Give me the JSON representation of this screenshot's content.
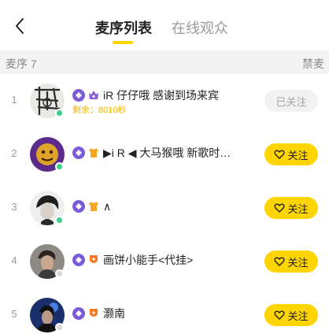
{
  "header": {
    "tabs": [
      {
        "label": "麦序列表",
        "active": true
      },
      {
        "label": "在线观众",
        "active": false
      }
    ],
    "accent_color": "#ffd500"
  },
  "subbar": {
    "queue_label": "麦序 7",
    "mute_label": "禁麦"
  },
  "rows": [
    {
      "index": "1",
      "name": "iR 仔仔哦 感谢到场来宾",
      "remaining": "剩余：8010秒",
      "button": "已关注",
      "followed": true,
      "online": true,
      "role_color": "#8a5bd6"
    },
    {
      "index": "2",
      "name": "▶i R ◀ 大马猴哦 新歌时…",
      "button": "关注",
      "followed": false,
      "online": true,
      "role_color": "#f5a623"
    },
    {
      "index": "3",
      "name": "∧",
      "button": "关注",
      "followed": false,
      "online": true,
      "role_color": "#f5a623"
    },
    {
      "index": "4",
      "name": "画饼小能手<代挂>",
      "button": "关注",
      "followed": false,
      "online": false,
      "role_color": "#f57c23"
    },
    {
      "index": "5",
      "name": "灏南",
      "button": "关注",
      "followed": false,
      "online": false,
      "role_color": "#f57c23"
    }
  ]
}
